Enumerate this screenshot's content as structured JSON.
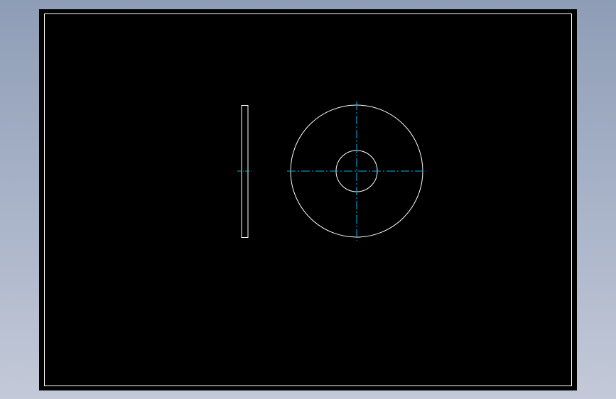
{
  "colors": {
    "background_gradient_top": "#8e9db6",
    "background_gradient_bottom": "#c3c9d8",
    "sheet": "#000000",
    "border": "#ffffff",
    "geometry": "#ffffff",
    "centerline": "#00b4e6"
  },
  "drawing": {
    "views": [
      "side-view-washer-profile",
      "front-view-washer"
    ],
    "centerline_style": "dash-dot"
  }
}
